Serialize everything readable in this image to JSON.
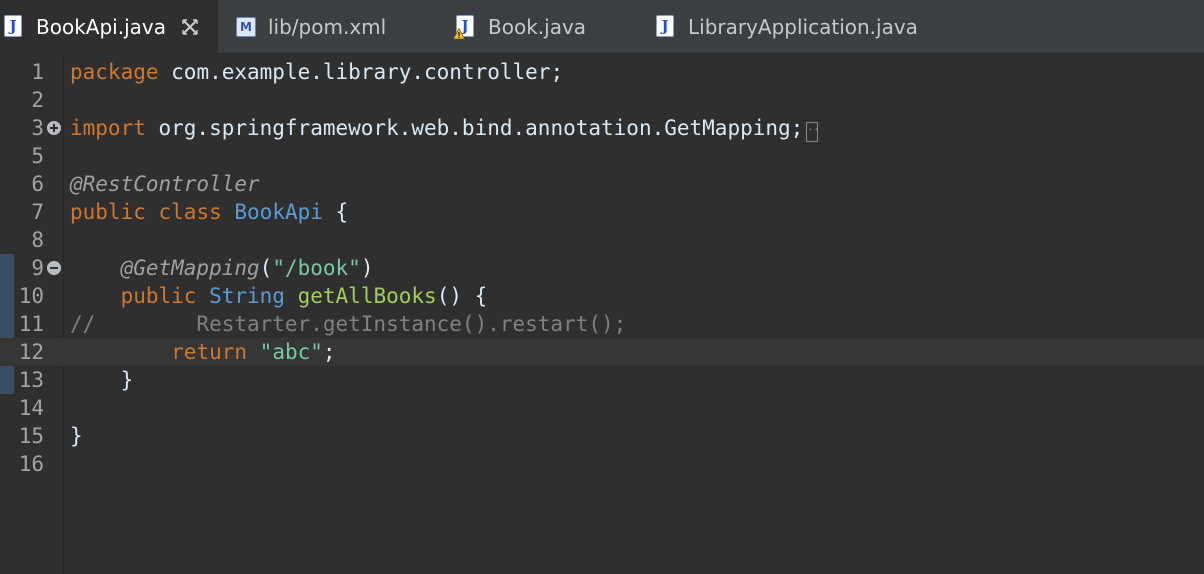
{
  "tabs": [
    {
      "label": "BookApi.java",
      "icon": "java-file-icon",
      "active": true,
      "closable": true
    },
    {
      "label": "lib/pom.xml",
      "icon": "maven-file-icon",
      "active": false
    },
    {
      "label": "Book.java",
      "icon": "java-file-warning-icon",
      "active": false
    },
    {
      "label": "LibraryApplication.java",
      "icon": "java-file-icon",
      "active": false
    }
  ],
  "icon_text": {
    "java": "J",
    "maven": "M"
  },
  "editor": {
    "current_line": 12,
    "lines": [
      {
        "n": "1",
        "tokens": [
          {
            "t": "package",
            "c": "kw"
          },
          {
            "t": " com.example.library.controller;",
            "c": "plain"
          }
        ]
      },
      {
        "n": "2",
        "tokens": []
      },
      {
        "n": "3",
        "fold": "expand",
        "collapsed": true,
        "tokens": [
          {
            "t": "import",
            "c": "kw"
          },
          {
            "t": " org.springframework.web.bind.annotation.GetMapping;",
            "c": "plain"
          }
        ]
      },
      {
        "n": "5",
        "tokens": []
      },
      {
        "n": "6",
        "tokens": [
          {
            "t": "@RestController",
            "c": "ann"
          }
        ]
      },
      {
        "n": "7",
        "tokens": [
          {
            "t": "public",
            "c": "kw"
          },
          {
            "t": " ",
            "c": "plain"
          },
          {
            "t": "class",
            "c": "kw"
          },
          {
            "t": " ",
            "c": "plain"
          },
          {
            "t": "BookApi",
            "c": "cls"
          },
          {
            "t": " {",
            "c": "plain"
          }
        ]
      },
      {
        "n": "8",
        "tokens": []
      },
      {
        "n": "9",
        "fold": "collapse",
        "tokens": [
          {
            "t": "    ",
            "c": "plain"
          },
          {
            "t": "@GetMapping",
            "c": "ann"
          },
          {
            "t": "(",
            "c": "plain"
          },
          {
            "t": "\"/book\"",
            "c": "str"
          },
          {
            "t": ")",
            "c": "plain"
          }
        ]
      },
      {
        "n": "10",
        "tokens": [
          {
            "t": "    ",
            "c": "plain"
          },
          {
            "t": "public",
            "c": "kw"
          },
          {
            "t": " ",
            "c": "plain"
          },
          {
            "t": "String",
            "c": "cls"
          },
          {
            "t": " ",
            "c": "plain"
          },
          {
            "t": "getAllBooks",
            "c": "mth"
          },
          {
            "t": "() {",
            "c": "plain"
          }
        ]
      },
      {
        "n": "11",
        "tokens": [
          {
            "t": "//        Restarter.getInstance().restart();",
            "c": "com"
          }
        ]
      },
      {
        "n": "12",
        "tokens": [
          {
            "t": "        ",
            "c": "plain"
          },
          {
            "t": "return",
            "c": "kw"
          },
          {
            "t": " ",
            "c": "plain"
          },
          {
            "t": "\"abc\"",
            "c": "str"
          },
          {
            "t": ";",
            "c": "plain"
          }
        ]
      },
      {
        "n": "13",
        "tokens": [
          {
            "t": "    }",
            "c": "plain"
          }
        ]
      },
      {
        "n": "14",
        "tokens": []
      },
      {
        "n": "15",
        "tokens": [
          {
            "t": "}",
            "c": "plain"
          }
        ]
      },
      {
        "n": "16",
        "tokens": []
      }
    ]
  },
  "colors": {
    "background": "#2f2f2f",
    "keyword": "#cc7832",
    "class": "#5b9bd5",
    "annotation": "#a0a0a0",
    "string": "#79c7a5",
    "method": "#9fcf5a",
    "comment": "#808080"
  }
}
